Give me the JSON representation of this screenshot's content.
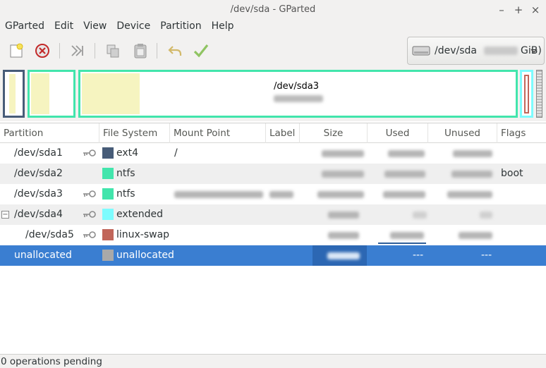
{
  "window": {
    "title": "/dev/sda - GParted",
    "controls": [
      "–",
      "+",
      "×"
    ]
  },
  "menu": [
    "GParted",
    "Edit",
    "View",
    "Device",
    "Partition",
    "Help"
  ],
  "toolbar": {
    "icons": [
      "new-icon",
      "delete-icon",
      "resize-move-icon",
      "copy-icon",
      "paste-icon",
      "undo-icon",
      "apply-icon"
    ]
  },
  "device_selector": {
    "device": "/dev/sda",
    "unit_suffix": "GiB)"
  },
  "disk_map": {
    "selected_partition": "/dev/sda3"
  },
  "table": {
    "headers": [
      "Partition",
      "File System",
      "Mount Point",
      "Label",
      "Size",
      "Used",
      "Unused",
      "Flags"
    ],
    "rows": [
      {
        "partition": "/dev/sda1",
        "locked": true,
        "fs": "ext4",
        "color": "#475c78",
        "mount": "/",
        "label": "",
        "used_blurred": true,
        "unused_blurred": true,
        "flags": ""
      },
      {
        "partition": "/dev/sda2",
        "locked": false,
        "fs": "ntfs",
        "color": "#42e5ac",
        "mount": "",
        "label": "",
        "used_blurred": true,
        "unused_blurred": true,
        "flags": "boot"
      },
      {
        "partition": "/dev/sda3",
        "locked": true,
        "fs": "ntfs",
        "color": "#42e5ac",
        "mount": "",
        "label": "",
        "used_blurred": true,
        "unused_blurred": true,
        "flags": ""
      },
      {
        "partition": "/dev/sda4",
        "locked": true,
        "fs": "extended",
        "color": "#7dfcfe",
        "mount": "",
        "label": "",
        "used_blurred": true,
        "unused_blurred": true,
        "flags": "",
        "expander": "−"
      },
      {
        "partition": "/dev/sda5",
        "locked": true,
        "fs": "linux-swap",
        "color": "#c1665a",
        "mount": "",
        "label": "",
        "used_blurred": true,
        "unused_blurred": true,
        "flags": ""
      },
      {
        "partition": "unallocated",
        "locked": false,
        "fs": "unallocated",
        "color": "#a9a9a9",
        "mount": "",
        "label": "",
        "used": "---",
        "unused": "---",
        "flags": ""
      }
    ]
  },
  "status": {
    "text": "0 operations pending"
  }
}
